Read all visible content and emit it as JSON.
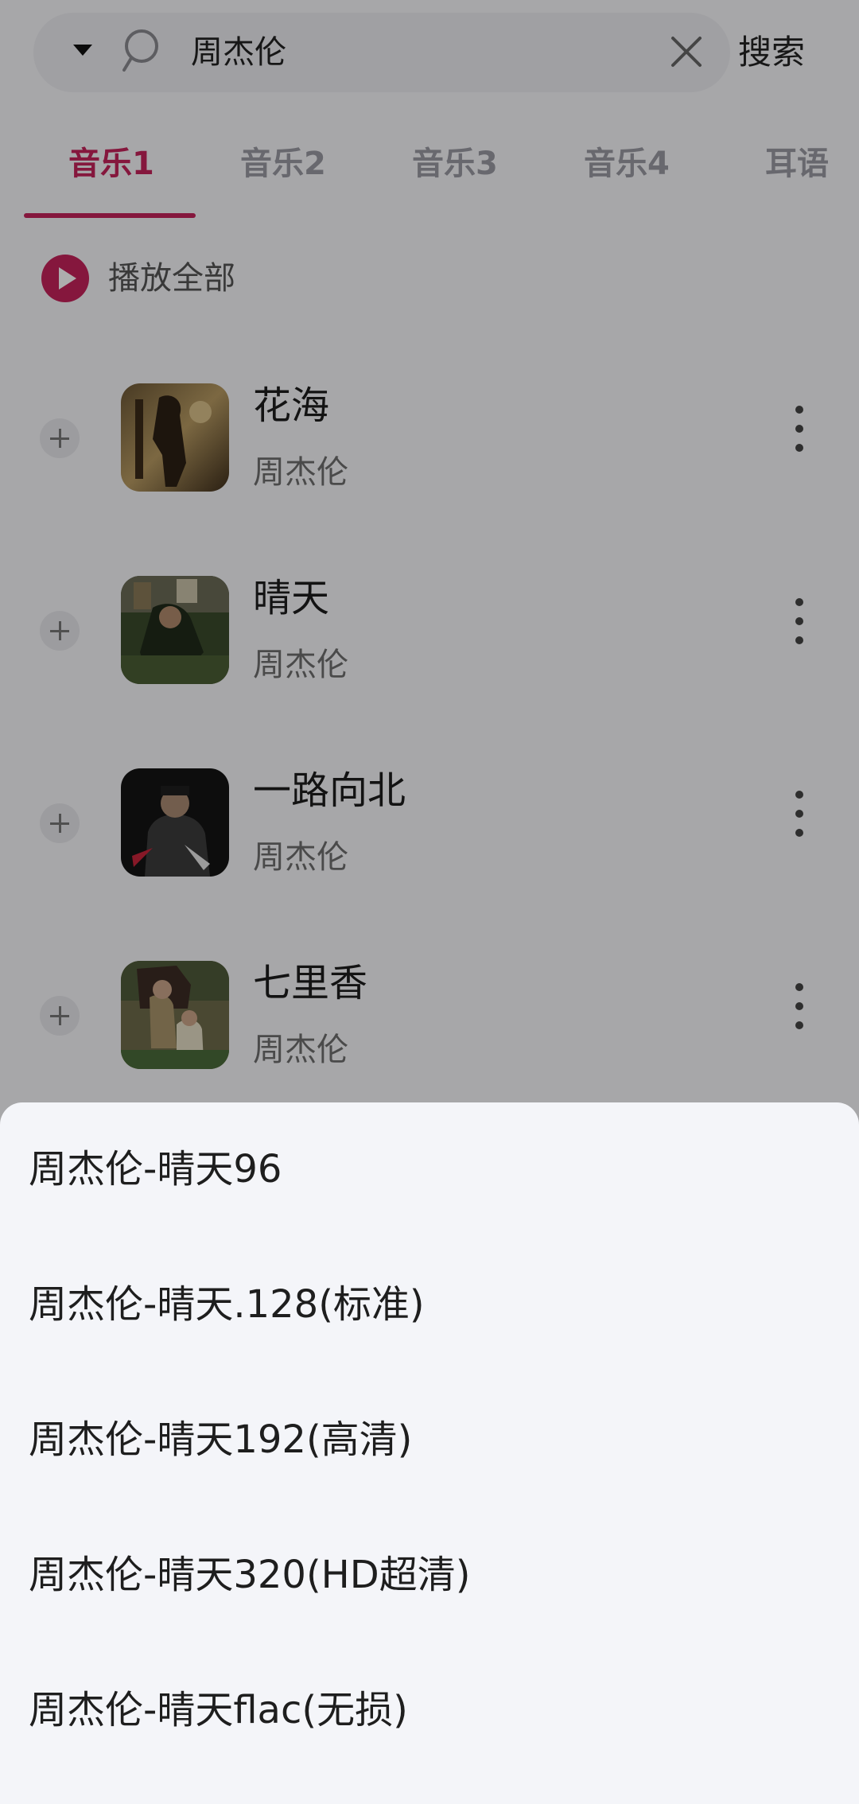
{
  "search": {
    "query": "周杰伦",
    "button_label": "搜索"
  },
  "tabs": [
    {
      "label": "音乐1",
      "active": true
    },
    {
      "label": "音乐2",
      "active": false
    },
    {
      "label": "音乐3",
      "active": false
    },
    {
      "label": "音乐4",
      "active": false
    },
    {
      "label": "耳语",
      "active": false
    }
  ],
  "play_all": {
    "label": "播放全部"
  },
  "songs": [
    {
      "title": "花海",
      "artist": "周杰伦"
    },
    {
      "title": "晴天",
      "artist": "周杰伦"
    },
    {
      "title": "一路向北",
      "artist": "周杰伦"
    },
    {
      "title": "七里香",
      "artist": "周杰伦"
    }
  ],
  "quality_sheet": {
    "options": [
      "周杰伦-晴天96",
      "周杰伦-晴天.128(标准)",
      "周杰伦-晴天192(高清)",
      "周杰伦-晴天320(HD超清)",
      "周杰伦-晴天flac(无损)"
    ]
  },
  "colors": {
    "accent": "#c4235a",
    "sheet_background": "#f4f5f9"
  },
  "icons": [
    "dropdown-arrow-icon",
    "search-icon",
    "clear-icon",
    "play-circle-icon",
    "add-icon",
    "more-vertical-icon"
  ]
}
